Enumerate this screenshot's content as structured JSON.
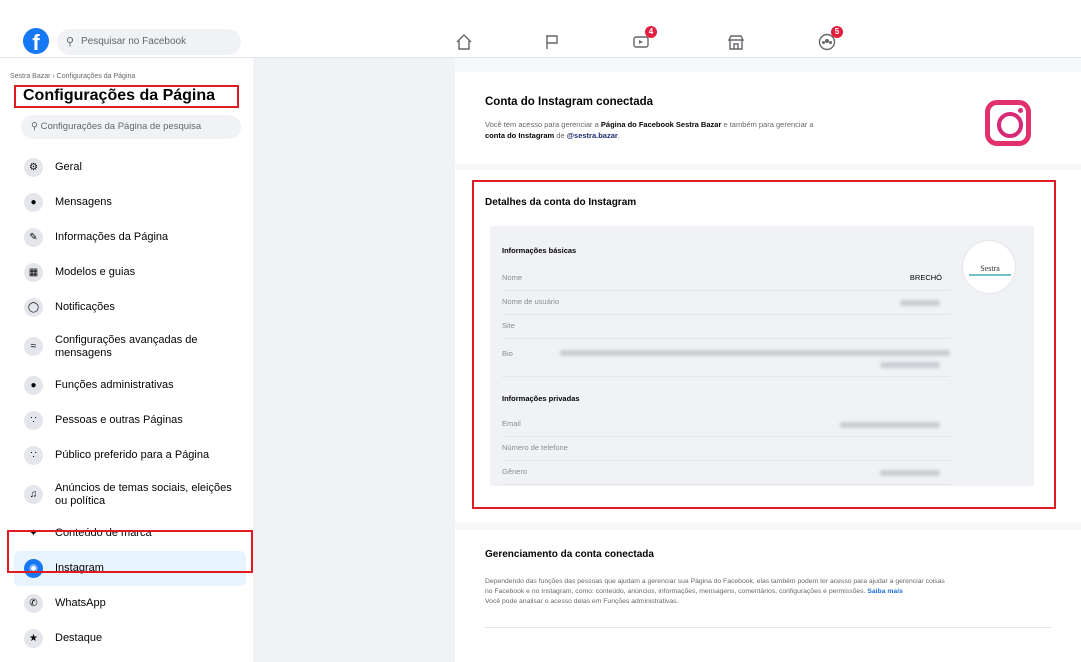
{
  "topbar": {
    "logo_letter": "f",
    "search_placeholder": "Pesquisar no Facebook",
    "nav": [
      {
        "name": "home-icon",
        "badge": ""
      },
      {
        "name": "pages-flag-icon",
        "badge": ""
      },
      {
        "name": "watch-video-icon",
        "badge": "4"
      },
      {
        "name": "marketplace-icon",
        "badge": ""
      },
      {
        "name": "groups-icon",
        "badge": "5"
      }
    ]
  },
  "sidebar": {
    "breadcrumb": "Sestra Bazar › Configurações da Página",
    "title": "Configurações da Página",
    "search_placeholder": "Configurações da Página de pesquisa",
    "items": [
      {
        "label": "Geral",
        "icon": "gear-icon"
      },
      {
        "label": "Mensagens",
        "icon": "chat-icon"
      },
      {
        "label": "Informações da Página",
        "icon": "pencil-icon"
      },
      {
        "label": "Modelos e guias",
        "icon": "grid-icon"
      },
      {
        "label": "Notificações",
        "icon": "globe-icon"
      },
      {
        "label": "Configurações avançadas de mensagens",
        "icon": "messenger-icon"
      },
      {
        "label": "Funções administrativas",
        "icon": "person-icon"
      },
      {
        "label": "Pessoas e outras Páginas",
        "icon": "people-icon"
      },
      {
        "label": "Público preferido para a Página",
        "icon": "people-icon"
      },
      {
        "label": "Anúncios de temas sociais, eleições ou política",
        "icon": "megaphone-icon"
      },
      {
        "label": "Conteúdo de marca",
        "icon": "handshake-icon"
      },
      {
        "label": "Instagram",
        "icon": "instagram-icon"
      },
      {
        "label": "WhatsApp",
        "icon": "whatsapp-icon"
      },
      {
        "label": "Destaque",
        "icon": "star-icon"
      }
    ]
  },
  "connected": {
    "title": "Conta do Instagram conectada",
    "desc_1": "Você tem acesso para gerenciar a ",
    "desc_page": "Página do Facebook Sestra Bazar",
    "desc_2": " e também para gerenciar a ",
    "desc_account": "conta do Instagram",
    "desc_3": " de ",
    "desc_handle": "@sestra.bazar",
    "desc_4": "."
  },
  "details": {
    "title": "Detalhes da conta do Instagram",
    "basic_title": "Informações básicas",
    "rows_basic": [
      {
        "key": "Nome",
        "value": "BRECHÓ"
      },
      {
        "key": "Nome de usuário",
        "value": ""
      },
      {
        "key": "Site",
        "value": ""
      },
      {
        "key": "Bio",
        "value": ""
      }
    ],
    "private_title": "Informações privadas",
    "rows_private": [
      {
        "key": "Email",
        "value": ""
      },
      {
        "key": "Número de telefone",
        "value": ""
      },
      {
        "key": "Gênero",
        "value": ""
      }
    ],
    "avatar_text": "Sestra"
  },
  "management": {
    "title": "Gerenciamento da conta conectada",
    "line1": "Dependendo das funções das pessoas que ajudam a gerenciar sua Página do Facebook, elas também podem ter acesso para ajudar a gerenciar coisas",
    "line2": "no Facebook e no Instagram, como: conteúdo, anúncios, informações, mensagens, comentários, configurações e permissões.",
    "link": "Saiba mais",
    "line3": "Você pode analisar o acesso delas em Funções administrativas."
  },
  "colors": {
    "accent": "#1877f2",
    "highlight": "#e01b24",
    "instagram": "#e1306c"
  }
}
